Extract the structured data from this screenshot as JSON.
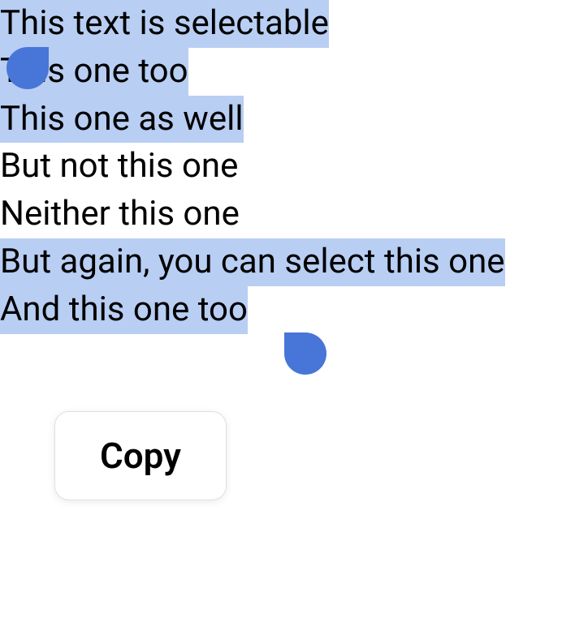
{
  "colors": {
    "selectionBackground": "#b8cef3",
    "selectionHandle": "#4876d8",
    "text": "#000000"
  },
  "lines": [
    {
      "text": "This text is selectable",
      "highlighted": true
    },
    {
      "text": "This one too",
      "highlighted": true
    },
    {
      "text": "This one as well",
      "highlighted": true
    },
    {
      "text": "But not this one",
      "highlighted": false
    },
    {
      "text": "Neither this one",
      "highlighted": false
    },
    {
      "text": "But again, you can select this one",
      "highlighted": true
    },
    {
      "text": "And this one too",
      "highlighted": true
    }
  ],
  "popup": {
    "copyLabel": "Copy"
  }
}
